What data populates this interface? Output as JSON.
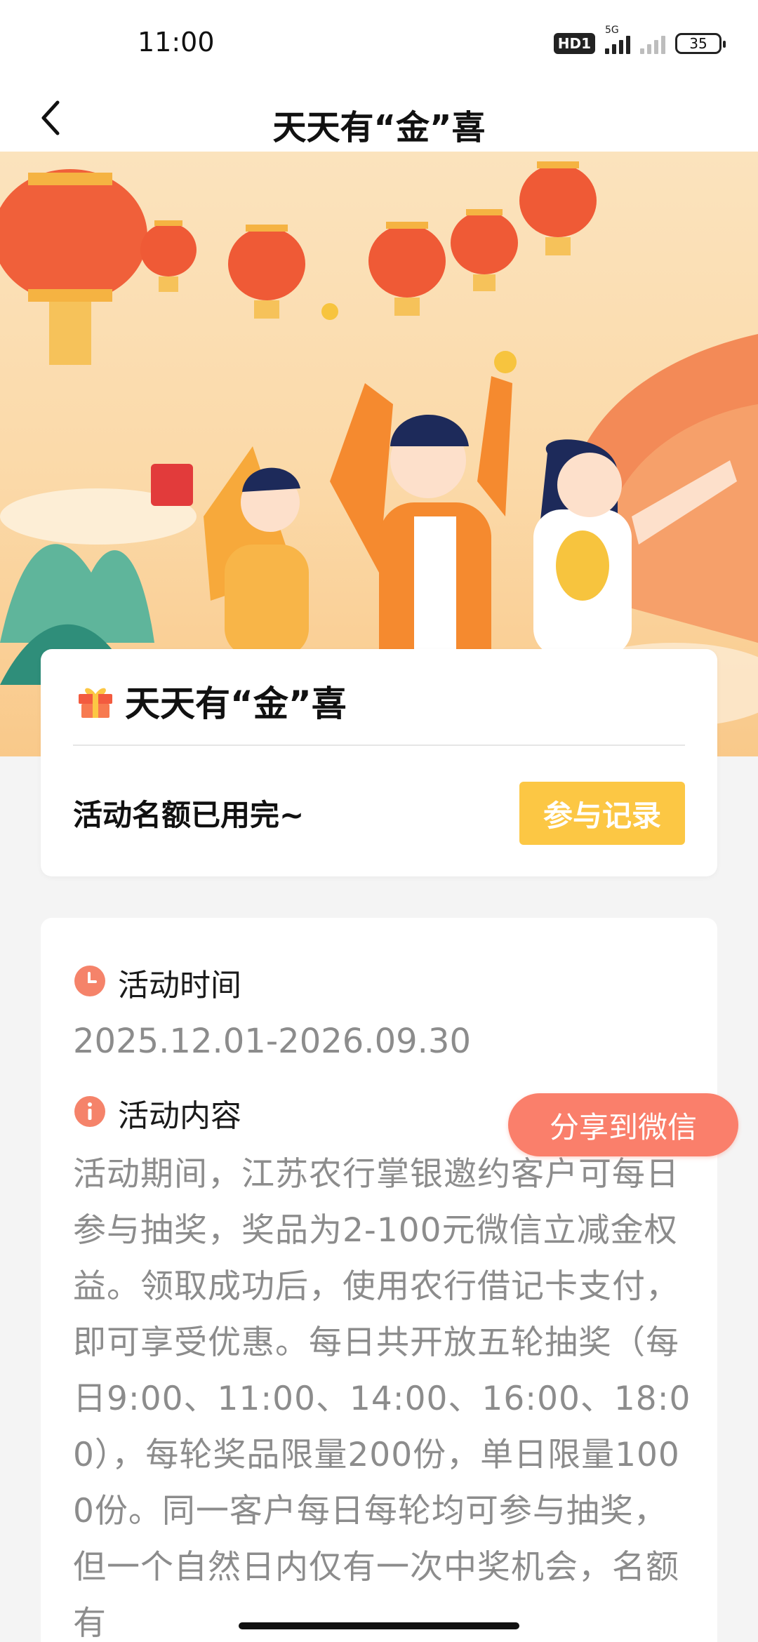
{
  "status_bar": {
    "time": "11:00",
    "hd_badge": "HD1",
    "network": "5G",
    "battery": "35"
  },
  "nav": {
    "title": "天天有“金”喜",
    "back_icon": "chevron-left-icon"
  },
  "banner": {
    "image": "festive-lanterns-celebration-illustration"
  },
  "activity_card": {
    "title": "天天有“金”喜",
    "icon": "gift-icon",
    "status_text": "活动名额已用完~",
    "record_button_label": "参与记录"
  },
  "details": {
    "time_label": "活动时间",
    "time_value": "2025.12.01-2026.09.30",
    "content_label": "活动内容",
    "content_text": "活动期间，江苏农行掌银邀约客户可每日参与抽奖，奖品为2-100元微信立减金权益。领取成功后，使用农行借记卡支付，即可享受优惠。每日共开放五轮抽奖（每日9:00、11:00、14:00、16:00、18:00），每轮奖品限量200份，单日限量1000份。同一客户每日每轮均可参与抽奖，但一个自然日内仅有一次中奖机会，名额有"
  },
  "share_button_label": "分享到微信",
  "colors": {
    "accent_yellow": "#fcc744",
    "share_red": "#fa7f6b",
    "icon_red": "#f5836a"
  }
}
